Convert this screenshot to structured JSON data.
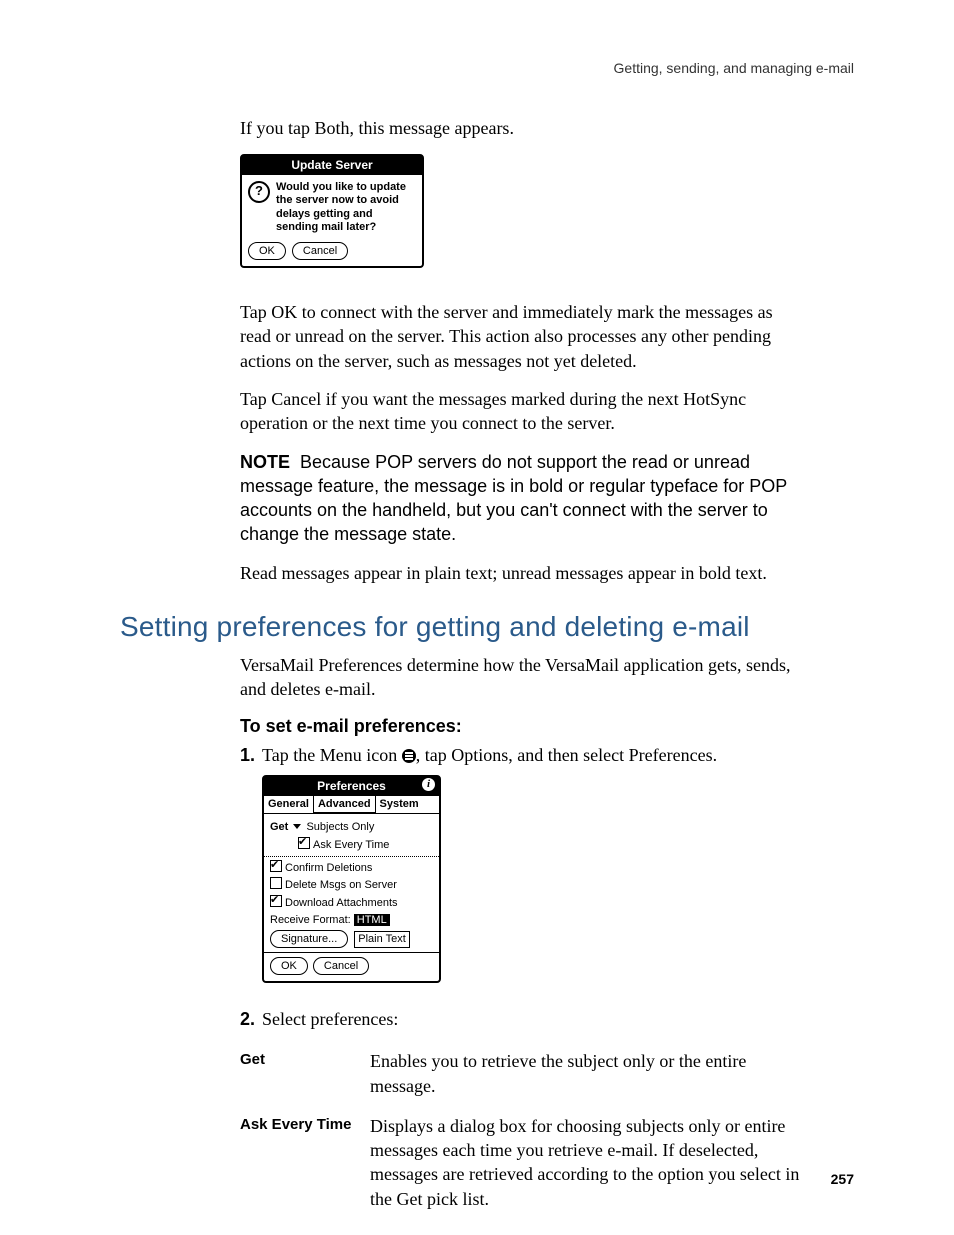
{
  "running_head": "Getting, sending, and managing e-mail",
  "intro_para": "If you tap Both, this message appears.",
  "dialog1": {
    "title": "Update Server",
    "question_glyph": "?",
    "message": "Would you like to update the server now to avoid delays getting and sending mail later?",
    "ok_label": "OK",
    "cancel_label": "Cancel"
  },
  "para_ok": "Tap OK to connect with the server and immediately mark the messages as read or unread on the server. This action also processes any other pending actions on the server, such as messages not yet deleted.",
  "para_cancel": "Tap Cancel if you want the messages marked during the next HotSync operation or the next time you connect to the server.",
  "note_label": "NOTE",
  "note_body": "Because POP servers do not support the read or unread message feature, the message is in bold or regular typeface for POP accounts on the handheld, but you can't connect with the server to change the message state.",
  "para_readstate": "Read messages appear in plain text; unread messages appear in bold text.",
  "section_heading": "Setting preferences for getting and deleting e-mail",
  "section_intro": "VersaMail Preferences determine how the VersaMail application gets, sends, and deletes e-mail.",
  "proc_heading": "To set e-mail preferences:",
  "step1_num": "1.",
  "step1_a": "Tap the Menu icon ",
  "step1_b": ", tap Options, and then select Preferences.",
  "prefs": {
    "title": "Preferences",
    "info_glyph": "i",
    "tabs": [
      "General",
      "Advanced",
      "System"
    ],
    "get_label": "Get",
    "get_value": "Subjects Only",
    "ask_label": "Ask Every Time",
    "confirm_label": "Confirm Deletions",
    "delete_label": "Delete Msgs on Server",
    "download_label": "Download Attachments",
    "receive_format_label": "Receive Format:",
    "receive_format_sel": "HTML",
    "receive_format_alt": "Plain Text",
    "signature_label": "Signature...",
    "ok_label": "OK",
    "cancel_label": "Cancel"
  },
  "step2_num": "2.",
  "step2_text": "Select preferences:",
  "defs": {
    "get_term": "Get",
    "get_desc": "Enables you to retrieve the subject only or the entire message.",
    "ask_term": "Ask Every Time",
    "ask_desc": "Displays a dialog box for choosing subjects only or entire messages each time you retrieve e-mail. If deselected, messages are retrieved according to the option you select in the Get pick list."
  },
  "page_number": "257"
}
